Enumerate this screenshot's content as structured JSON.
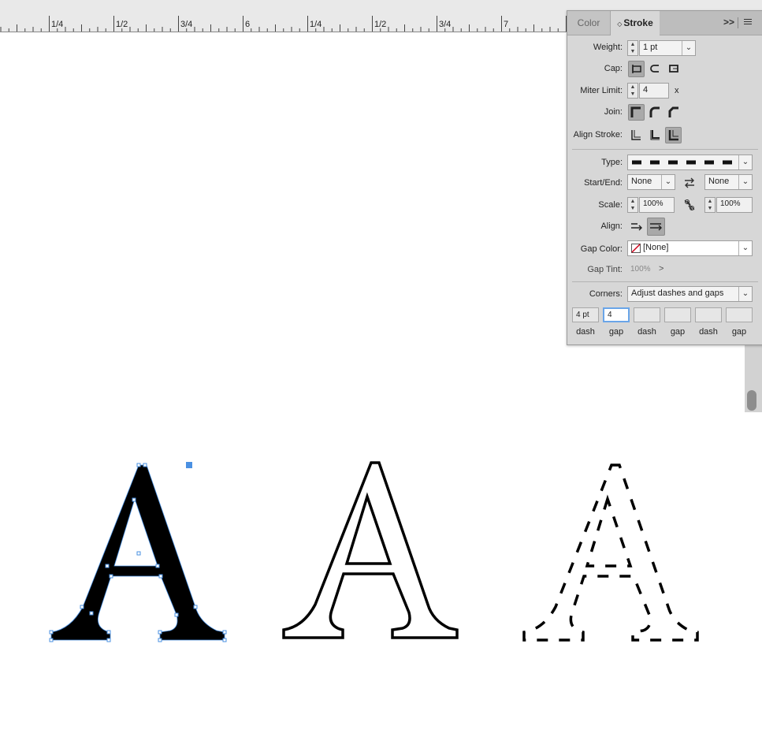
{
  "ruler": {
    "labels": [
      "1/4",
      "1/2",
      "3/4",
      "6",
      "1/4",
      "1/2",
      "3/4",
      "7"
    ]
  },
  "panel": {
    "tabs": {
      "color": "Color",
      "stroke": "Stroke"
    },
    "expand_glyph": ">>",
    "weight": {
      "label": "Weight:",
      "value": "1 pt"
    },
    "cap": {
      "label": "Cap:"
    },
    "miter": {
      "label": "Miter Limit:",
      "value": "4",
      "suffix": "x"
    },
    "join": {
      "label": "Join:"
    },
    "align_stroke": {
      "label": "Align Stroke:"
    },
    "type": {
      "label": "Type:"
    },
    "start_end": {
      "label": "Start/End:",
      "start": "None",
      "end": "None"
    },
    "scale": {
      "label": "Scale:",
      "start": "100%",
      "end": "100%"
    },
    "align": {
      "label": "Align:"
    },
    "gap_color": {
      "label": "Gap Color:",
      "value": "[None]"
    },
    "gap_tint": {
      "label": "Gap Tint:",
      "value": "100%",
      "arrow": ">"
    },
    "corners": {
      "label": "Corners:",
      "value": "Adjust dashes and gaps"
    },
    "dash_gap": {
      "values": [
        "4 pt",
        "4",
        "",
        "",
        "",
        ""
      ],
      "labels": [
        "dash",
        "gap",
        "dash",
        "gap",
        "dash",
        "gap"
      ]
    }
  },
  "colors": {
    "selection": "#4a90e2",
    "panel_bg": "#d7d7d7",
    "accent": "#6aa5e8"
  }
}
